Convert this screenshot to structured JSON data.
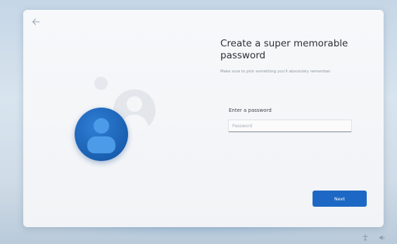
{
  "title": "Create a super memorable password",
  "subtitle": "Make sure to pick something you'll absolutely remember.",
  "password_field": {
    "label": "Enter a password",
    "placeholder": "Password",
    "value": ""
  },
  "next_button": {
    "label": "Next"
  },
  "icons": {
    "back": "back-arrow-icon",
    "accessibility": "accessibility-icon",
    "volume": "volume-icon",
    "avatar": "user-avatar-icon"
  },
  "colors": {
    "accent": "#1d68c4",
    "avatar_blue": "#1a5fb0",
    "card_background": "#f5f6f8"
  }
}
